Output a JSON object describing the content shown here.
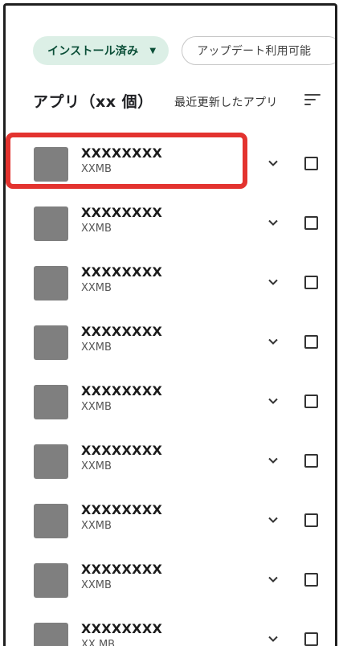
{
  "filters": {
    "installed_label": "インストール済み",
    "installed_caret": "▼",
    "update_label": "アップデート利用可能"
  },
  "header": {
    "title": "アプリ（xx 個）",
    "sort_label": "最近更新したアプリ"
  },
  "apps": [
    {
      "name": "XXXXXXXX",
      "size": "XXMB"
    },
    {
      "name": "XXXXXXXX",
      "size": "XXMB"
    },
    {
      "name": "XXXXXXXX",
      "size": "XXMB"
    },
    {
      "name": "XXXXXXXX",
      "size": "XXMB"
    },
    {
      "name": "XXXXXXXX",
      "size": "XXMB"
    },
    {
      "name": "XXXXXXXX",
      "size": "XXMB"
    },
    {
      "name": "XXXXXXXX",
      "size": "XXMB"
    },
    {
      "name": "XXXXXXXX",
      "size": "XXMB"
    },
    {
      "name": "XXXXXXXX",
      "size": "XX MB"
    }
  ],
  "colors": {
    "installed_chip_bg": "#dcefe6",
    "installed_chip_text": "#0b4f38",
    "app_icon_placeholder": "#7f7f7f",
    "highlight_border": "#e3332f"
  },
  "icons": {
    "sort": "sort-icon",
    "expand": "chevron-down-icon",
    "select": "checkbox-icon"
  }
}
